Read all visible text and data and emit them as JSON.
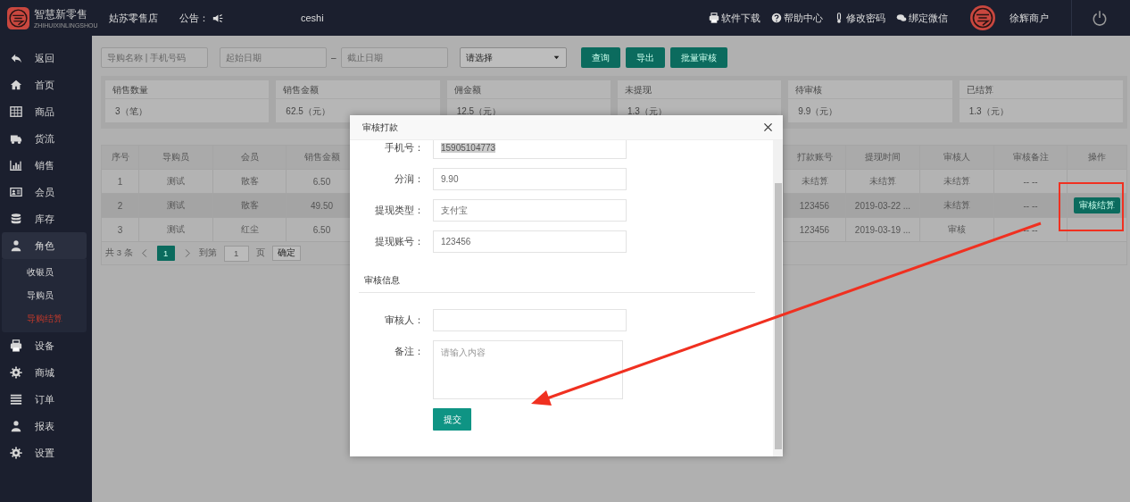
{
  "header": {
    "logo": {
      "title": "智慧新零售",
      "subtitle": "ZHIHUIXINLINGSHOU"
    },
    "store": "姑苏零售店",
    "notice_label": "公告：",
    "notice_text": "ceshi",
    "links": [
      "软件下载",
      "帮助中心",
      "修改密码",
      "绑定微信"
    ],
    "user": "徐辉商户"
  },
  "sidebar": {
    "items": [
      {
        "label": "返回",
        "expanded": false
      },
      {
        "label": "首页",
        "expanded": false
      },
      {
        "label": "商品",
        "expanded": false
      },
      {
        "label": "货流",
        "expanded": false
      },
      {
        "label": "销售",
        "expanded": false
      },
      {
        "label": "会员",
        "expanded": false
      },
      {
        "label": "库存",
        "expanded": false
      },
      {
        "label": "角色",
        "expanded": true,
        "children": [
          {
            "label": "收银员",
            "selected": false
          },
          {
            "label": "导购员",
            "selected": false
          },
          {
            "label": "导购结算",
            "selected": true
          }
        ]
      },
      {
        "label": "设备",
        "expanded": false
      },
      {
        "label": "商城",
        "expanded": false
      },
      {
        "label": "订单",
        "expanded": false
      },
      {
        "label": "报表",
        "expanded": false
      },
      {
        "label": "设置",
        "expanded": false
      }
    ]
  },
  "filters": {
    "search_placeholder": "导购名称 | 手机号码",
    "start_placeholder": "起始日期",
    "separator": "–",
    "end_placeholder": "截止日期",
    "select_value": "请选择",
    "buttons": [
      "查询",
      "导出",
      "批量审核"
    ]
  },
  "stats": [
    {
      "label": "销售数量",
      "value": "3（笔）"
    },
    {
      "label": "销售金额",
      "value": "62.5（元）"
    },
    {
      "label": "佣金额",
      "value": "12.5（元）"
    },
    {
      "label": "未提现",
      "value": "1.3（元）"
    },
    {
      "label": "待审核",
      "value": "9.9（元）"
    },
    {
      "label": "已结算",
      "value": "1.3（元）"
    }
  ],
  "table": {
    "columns": [
      "序号",
      "导购员",
      "会员",
      "销售金额",
      "打款账号",
      "提现时间",
      "审核人",
      "审核备注",
      "操作"
    ],
    "rows": [
      {
        "selected": false,
        "cells": [
          "1",
          "测试",
          "散客",
          "6.50",
          "未结算",
          "未结算",
          "未结算",
          "-- --"
        ]
      },
      {
        "selected": true,
        "cells": [
          "2",
          "测试",
          "散客",
          "49.50",
          "123456",
          "2019-03-22 ...",
          "未结算",
          "-- --"
        ],
        "action": "审核结算"
      },
      {
        "selected": false,
        "cells": [
          "3",
          "测试",
          "红尘",
          "6.50",
          "123456",
          "2019-03-19 ...",
          "审核",
          "-- --"
        ]
      }
    ]
  },
  "pagination": {
    "total": "共 3 条",
    "pages": [
      {
        "label": "1",
        "selected": true
      }
    ],
    "goto_label": "到第",
    "goto_value": "1",
    "page_label": "页",
    "confirm": "确定"
  },
  "dialog": {
    "title": "审核打款",
    "fields": [
      {
        "label": "手机号：",
        "value": "15905104773",
        "highlighted": true
      },
      {
        "label": "分润：",
        "value": "9.90",
        "highlighted": false
      },
      {
        "label": "提现类型：",
        "value": "支付宝",
        "highlighted": false
      },
      {
        "label": "提现账号：",
        "value": "123456",
        "highlighted": false
      }
    ],
    "section": "审核信息",
    "review_fields": [
      {
        "kind": "input",
        "label": "审核人："
      },
      {
        "kind": "textarea",
        "label": "备注：",
        "placeholder": "请输入内容"
      }
    ],
    "submit": "提交"
  }
}
